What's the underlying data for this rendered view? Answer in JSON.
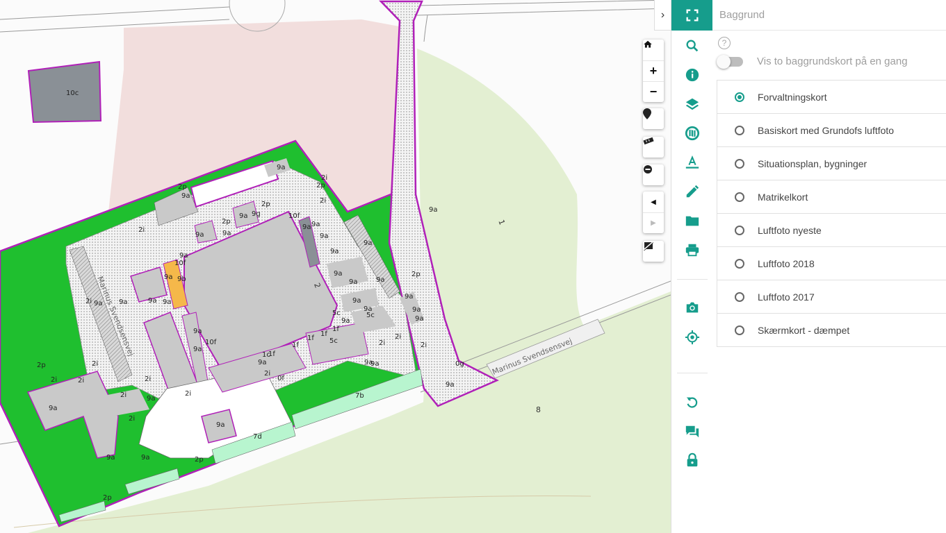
{
  "panel": {
    "title": "Baggrund",
    "toggle_label": "Vis to baggrundskort på en gang",
    "help_symbol": "?",
    "options": [
      {
        "label": "Forvaltningskort",
        "selected": true
      },
      {
        "label": "Basiskort med Grundofs luftfoto",
        "selected": false
      },
      {
        "label": "Situationsplan, bygninger",
        "selected": false
      },
      {
        "label": "Matrikelkort",
        "selected": false
      },
      {
        "label": "Luftfoto nyeste",
        "selected": false
      },
      {
        "label": "Luftfoto 2018",
        "selected": false
      },
      {
        "label": "Luftfoto 2017",
        "selected": false
      },
      {
        "label": "Skærmkort - dæmpet",
        "selected": false
      }
    ]
  },
  "map": {
    "street_label": "Marinus Svendsensvej",
    "parcel_numbers": [
      "1",
      "2",
      "8"
    ],
    "zone_labels": [
      "10c",
      "9a",
      "2i",
      "2p",
      "10f",
      "9b",
      "9g",
      "5c",
      "1f",
      "1c",
      "0f",
      "0g",
      "7b",
      "7d",
      "2",
      "1"
    ]
  },
  "map_tools": {
    "home": "home-icon",
    "zoom_in": "+",
    "zoom_out": "−",
    "marker": "map-pin-icon",
    "measure": "ruler-icon",
    "clear": "minus-circle-icon",
    "back": "◀",
    "forward": "▶",
    "legend": "legend-toggle-icon",
    "collapse": "›"
  },
  "colors": {
    "accent": "#169d8c",
    "green_area": "#1fbf2f",
    "building_gray": "#c9c9c9",
    "dark_gray": "#8a9096",
    "boundary_purple": "#b020b8",
    "light_green": "#e3efd2",
    "pink_area": "#f2dedd",
    "orange": "#f5b84a",
    "mint": "#b8f5cf"
  }
}
